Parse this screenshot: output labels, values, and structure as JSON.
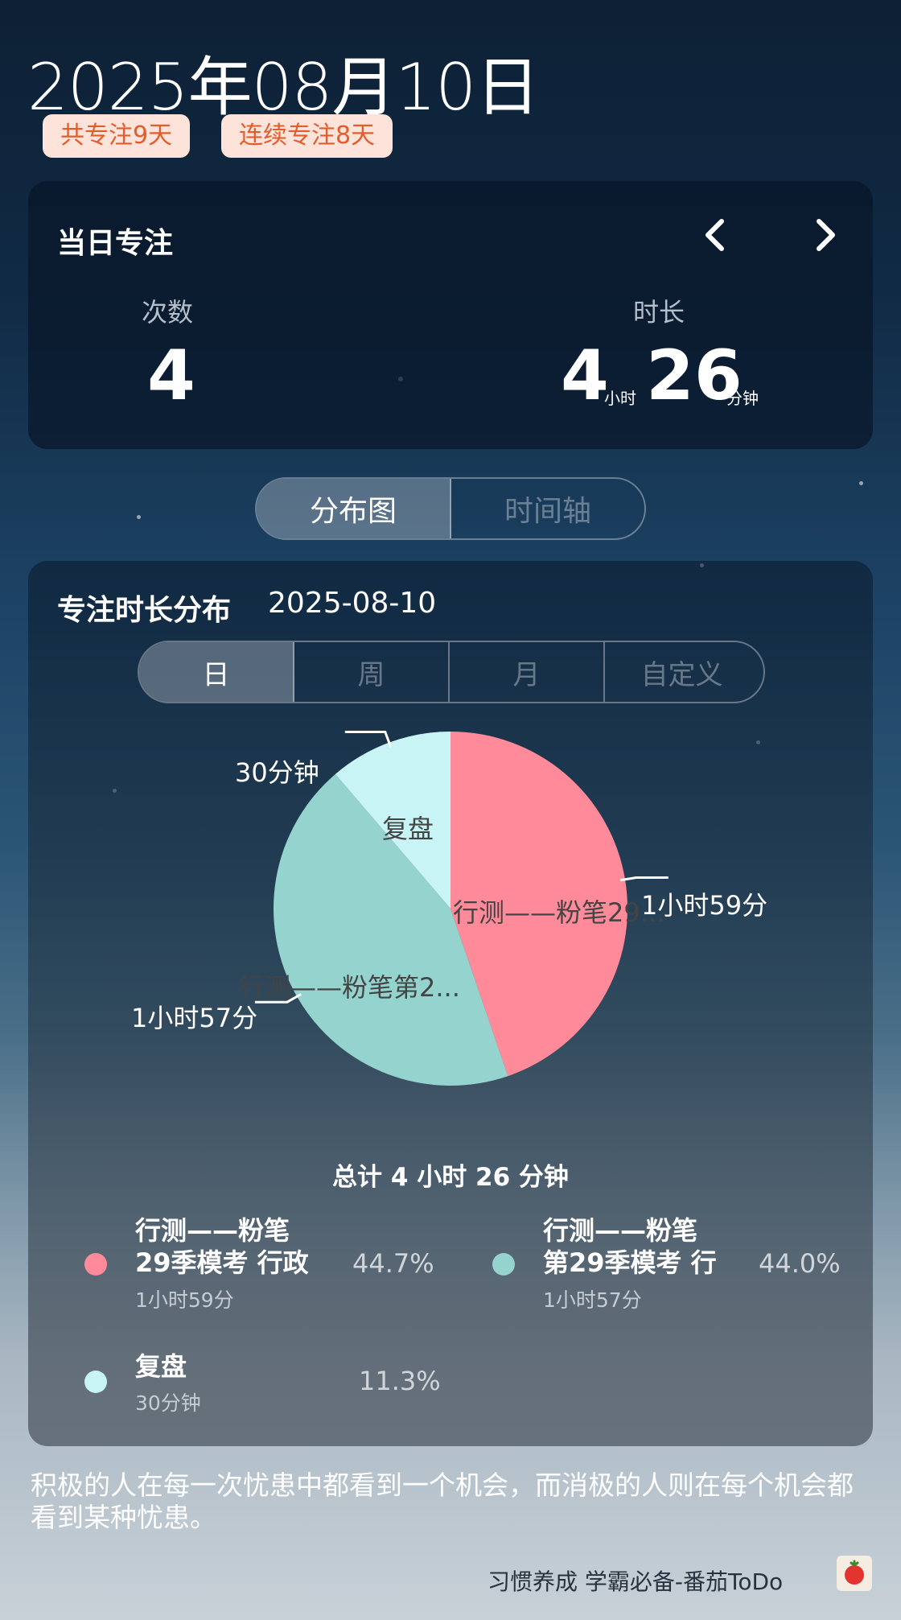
{
  "header": {
    "date": "2025年08月10日",
    "badges": [
      "共专注9天",
      "连续专注8天"
    ]
  },
  "daily": {
    "title": "当日专注",
    "count_label": "次数",
    "count_value": "4",
    "duration_label": "时长",
    "hours": "4",
    "hours_unit": "小时",
    "minutes": "26",
    "minutes_unit": "分钟"
  },
  "view_tabs": [
    "分布图",
    "时间轴"
  ],
  "distribution": {
    "title": "专注时长分布",
    "date": "2025-08-10",
    "period_tabs": [
      "日",
      "周",
      "月",
      "自定义"
    ],
    "total": "总计 4 小时 26 分钟"
  },
  "chart_data": {
    "type": "pie",
    "slices": [
      {
        "name": "行测——粉笔29季模考 行政",
        "short": "行测——粉笔29...",
        "value": 119,
        "label": "1小时59分",
        "percent": "44.7%",
        "color": "#ff8a99"
      },
      {
        "name": "行测——粉笔第29季模考 行",
        "short": "行测——粉笔第2...",
        "value": 117,
        "label": "1小时57分",
        "percent": "44.0%",
        "color": "#95d3ce"
      },
      {
        "name": "复盘",
        "short": "复盘",
        "value": 30,
        "label": "30分钟",
        "percent": "11.3%",
        "color": "#c8f4f6"
      }
    ]
  },
  "legend": [
    {
      "line1": "行测——粉笔",
      "line2": "29季模考 行政",
      "sub": "1小时59分",
      "pct": "44.7%"
    },
    {
      "line1": "行测——粉笔",
      "line2": "第29季模考 行",
      "sub": "1小时57分",
      "pct": "44.0%"
    },
    {
      "line1": "复盘",
      "line2": "",
      "sub": "30分钟",
      "pct": "11.3%"
    }
  ],
  "quote": "积极的人在每一次忧患中都看到一个机会，而消极的人则在每个机会都看到某种忧患。",
  "footer": "习惯养成 学霸必备-番茄ToDo",
  "icons": {
    "prev": "chevron-left-icon",
    "next": "chevron-right-icon",
    "app": "tomato-icon"
  }
}
